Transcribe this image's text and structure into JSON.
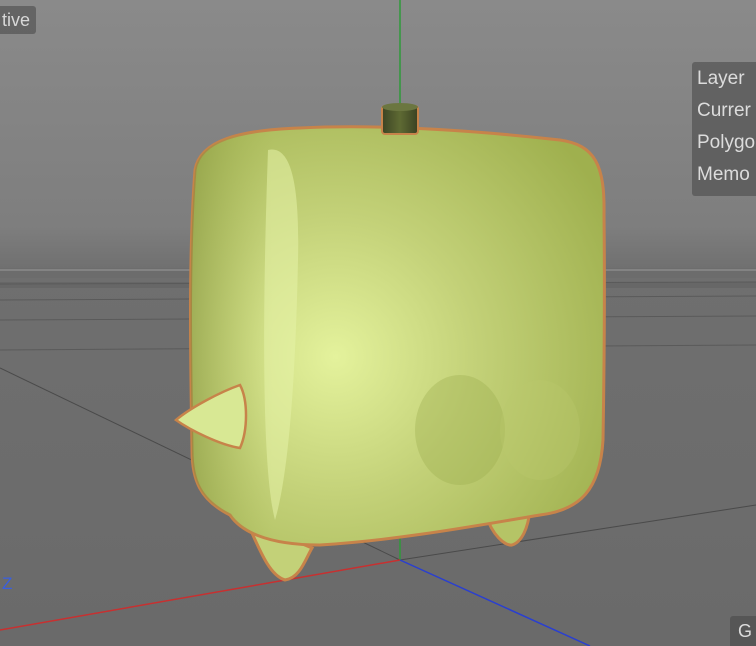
{
  "viewport": {
    "view_label": "tive",
    "hud_lines": [
      "Layer",
      "Currer",
      "Polygo",
      "Memo"
    ],
    "axis_label": "Z",
    "corner_label": "G"
  },
  "colors": {
    "background": "#7a7a7a",
    "object_fill": "#b5c466",
    "object_highlight": "#e2f09a",
    "object_outline": "#c7834a",
    "axis_y": "#2f9a3a",
    "axis_x": "#c83030",
    "axis_z": "#2a3fd0",
    "floor_grid": "#5a5a5a"
  },
  "object": {
    "icon": "green-blob-object-icon",
    "selected": true
  }
}
